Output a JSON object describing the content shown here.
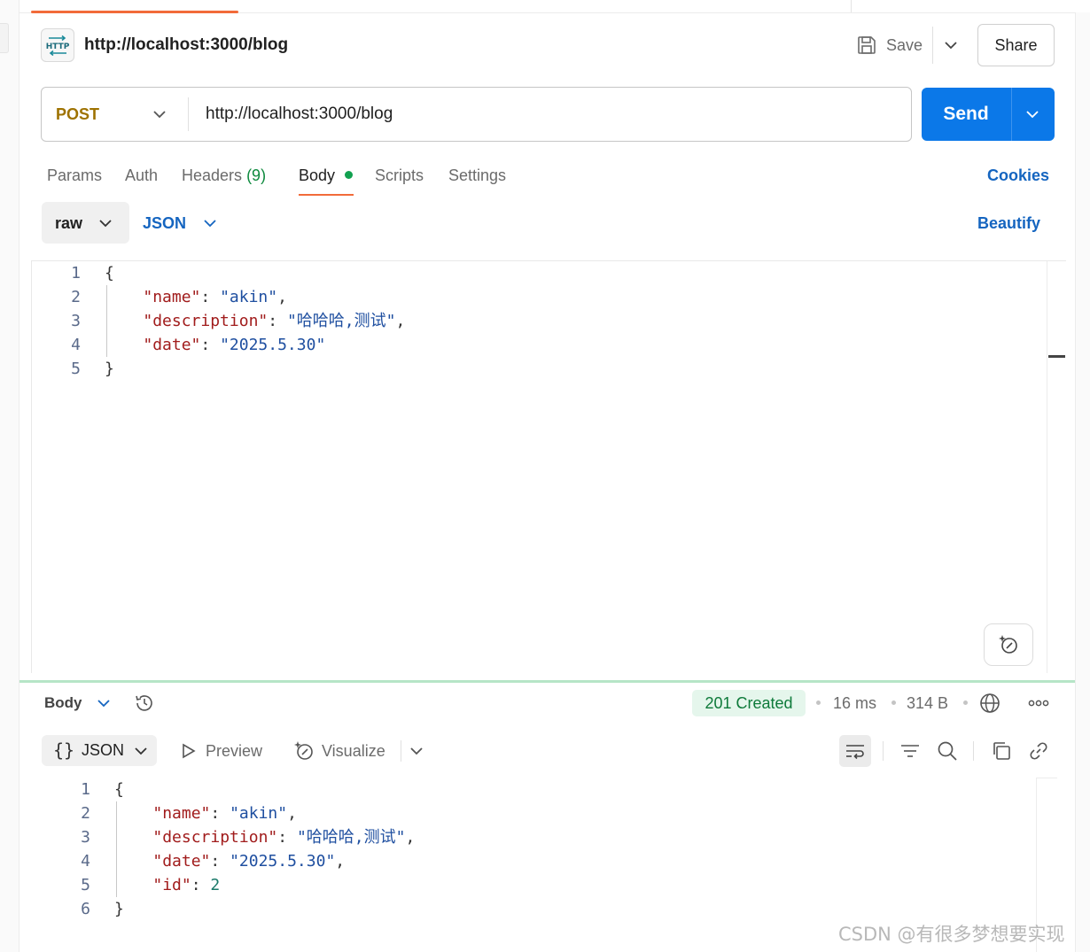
{
  "request": {
    "title": "http://localhost:3000/blog",
    "save_label": "Save",
    "share_label": "Share",
    "method": "POST",
    "url": "http://localhost:3000/blog",
    "send_label": "Send"
  },
  "request_tabs": {
    "params": "Params",
    "auth": "Auth",
    "headers": "Headers",
    "headers_count": "(9)",
    "body": "Body",
    "scripts": "Scripts",
    "settings": "Settings",
    "cookies": "Cookies"
  },
  "body_options": {
    "mode": "raw",
    "language": "JSON",
    "beautify": "Beautify"
  },
  "request_body": [
    {
      "num": "1",
      "parts": [
        {
          "t": "{",
          "c": "p"
        }
      ]
    },
    {
      "num": "2",
      "parts": [
        {
          "t": "    ",
          "c": "p"
        },
        {
          "t": "\"name\"",
          "c": "k"
        },
        {
          "t": ": ",
          "c": "p"
        },
        {
          "t": "\"akin\"",
          "c": "s"
        },
        {
          "t": ",",
          "c": "p"
        }
      ]
    },
    {
      "num": "3",
      "parts": [
        {
          "t": "    ",
          "c": "p"
        },
        {
          "t": "\"description\"",
          "c": "k"
        },
        {
          "t": ": ",
          "c": "p"
        },
        {
          "t": "\"哈哈哈,测试\"",
          "c": "s"
        },
        {
          "t": ",",
          "c": "p"
        }
      ]
    },
    {
      "num": "4",
      "parts": [
        {
          "t": "    ",
          "c": "p"
        },
        {
          "t": "\"date\"",
          "c": "k"
        },
        {
          "t": ": ",
          "c": "p"
        },
        {
          "t": "\"2025.5.30\"",
          "c": "s"
        }
      ]
    },
    {
      "num": "5",
      "parts": [
        {
          "t": "}",
          "c": "p"
        }
      ]
    }
  ],
  "response": {
    "body_label": "Body",
    "status": "201 Created",
    "time": "16 ms",
    "size": "314 B",
    "format": "JSON",
    "preview": "Preview",
    "visualize": "Visualize"
  },
  "response_body": [
    {
      "num": "1",
      "parts": [
        {
          "t": "{",
          "c": "p"
        }
      ]
    },
    {
      "num": "2",
      "parts": [
        {
          "t": "    ",
          "c": "p"
        },
        {
          "t": "\"name\"",
          "c": "k"
        },
        {
          "t": ": ",
          "c": "p"
        },
        {
          "t": "\"akin\"",
          "c": "s"
        },
        {
          "t": ",",
          "c": "p"
        }
      ]
    },
    {
      "num": "3",
      "parts": [
        {
          "t": "    ",
          "c": "p"
        },
        {
          "t": "\"description\"",
          "c": "k"
        },
        {
          "t": ": ",
          "c": "p"
        },
        {
          "t": "\"哈哈哈,测试\"",
          "c": "s"
        },
        {
          "t": ",",
          "c": "p"
        }
      ]
    },
    {
      "num": "4",
      "parts": [
        {
          "t": "    ",
          "c": "p"
        },
        {
          "t": "\"date\"",
          "c": "k"
        },
        {
          "t": ": ",
          "c": "p"
        },
        {
          "t": "\"2025.5.30\"",
          "c": "s"
        },
        {
          "t": ",",
          "c": "p"
        }
      ]
    },
    {
      "num": "5",
      "parts": [
        {
          "t": "    ",
          "c": "p"
        },
        {
          "t": "\"id\"",
          "c": "k"
        },
        {
          "t": ": ",
          "c": "p"
        },
        {
          "t": "2",
          "c": "n"
        }
      ]
    },
    {
      "num": "6",
      "parts": [
        {
          "t": "}",
          "c": "p"
        }
      ]
    }
  ],
  "watermark": "CSDN @有很多梦想要实现",
  "colors": {
    "accent_blue": "#0b78e8",
    "method_post": "#9e7200",
    "status_green": "#0e7a3a",
    "active_tab": "#f26b3a"
  }
}
